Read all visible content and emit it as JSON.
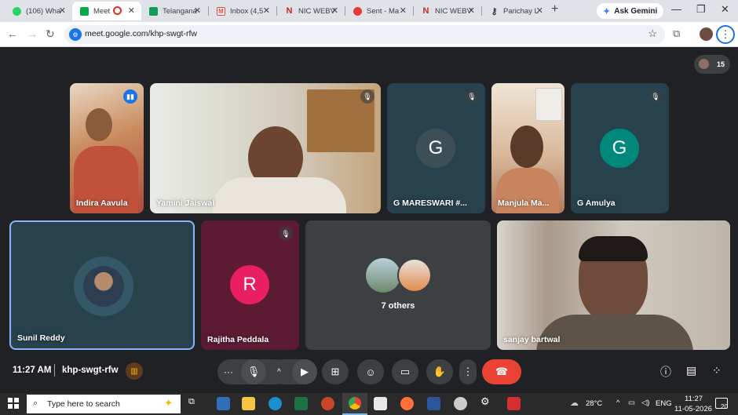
{
  "browser": {
    "tabs": [
      {
        "label": "(106) Wha",
        "icon": "whatsapp-icon",
        "color": "#25d366",
        "active": false
      },
      {
        "label": "Meet",
        "icon": "meet-icon",
        "color": "#00ac47",
        "active": true
      },
      {
        "label": "Telangana",
        "icon": "sheets-icon",
        "color": "#0f9d58",
        "active": false
      },
      {
        "label": "Inbox (4,5",
        "icon": "gmail-icon",
        "color": "#ea4335",
        "active": false
      },
      {
        "label": "NIC WEBV",
        "icon": "nic-icon",
        "color": "#c62828",
        "active": false
      },
      {
        "label": "Sent - Ma",
        "icon": "webmail-icon",
        "color": "#e53935",
        "active": false
      },
      {
        "label": "NIC WEBV",
        "icon": "nic-icon",
        "color": "#c62828",
        "active": false
      },
      {
        "label": "Parichay L",
        "icon": "key-icon",
        "color": "#5f6368",
        "active": false
      }
    ],
    "ask_gemini": "Ask Gemini",
    "url": "meet.google.com/khp-swgt-rfw"
  },
  "meet": {
    "participant_count": "15",
    "tiles": [
      {
        "name": "Indira Aavula",
        "kind": "video",
        "muted": false,
        "speaking": true
      },
      {
        "name": "Yamini Jaiswal",
        "kind": "video",
        "muted": true
      },
      {
        "name": "G MARESWARI #...",
        "kind": "avatar",
        "initial": "G",
        "muted": true
      },
      {
        "name": "Manjula Ma...",
        "kind": "video",
        "muted": false
      },
      {
        "name": "G Amulya",
        "kind": "avatar",
        "initial": "G",
        "muted": true
      },
      {
        "name": "Sunil Reddy",
        "kind": "photo-avatar",
        "muted": false,
        "pinned": true
      },
      {
        "name": "Rajitha Peddala",
        "kind": "avatar",
        "initial": "R",
        "muted": true
      },
      {
        "name": "7 others",
        "kind": "others"
      },
      {
        "name": "sanjay bartwal",
        "kind": "video",
        "muted": false
      }
    ],
    "time": "11:27 AM",
    "meeting_code": "khp-swgt-rfw"
  },
  "taskbar": {
    "search_placeholder": "Type here to search",
    "weather": "28°C",
    "lang": "ENG",
    "clock_time": "11:27",
    "clock_date": "11-05-2026",
    "notifications": "20"
  },
  "colors": {
    "accent": "#1a73e8",
    "end_call": "#ea4335",
    "avatar_teal": "#00897b",
    "avatar_pink": "#e91e63",
    "pinned_border": "#8ab4f8"
  }
}
